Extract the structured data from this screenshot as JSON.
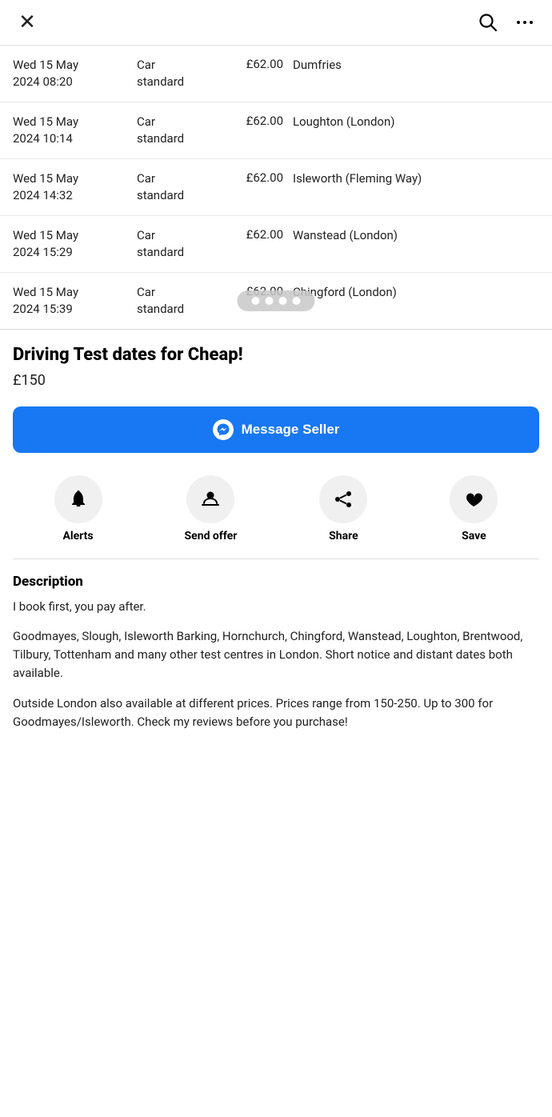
{
  "nav": {
    "close_label": "×",
    "search_label": "search",
    "more_label": "more options"
  },
  "table": {
    "rows": [
      {
        "date": "Wed 15 May 2024 08:20",
        "type": "Car standard",
        "price": "£62.00",
        "location": "Dumfries"
      },
      {
        "date": "Wed 15 May 2024 10:14",
        "type": "Car standard",
        "price": "£62.00",
        "location": "Loughton (London)"
      },
      {
        "date": "Wed 15 May 2024 14:32",
        "type": "Car standard",
        "price": "£62.00",
        "location": "Isleworth (Fleming Way)"
      },
      {
        "date": "Wed 15 May 2024 15:29",
        "type": "Car standard",
        "price": "£62.00",
        "location": "Wanstead (London)"
      },
      {
        "date": "Wed 15 May 2024 15:39",
        "type": "Car standard",
        "price": "£62.00",
        "location": "Chingford (London)"
      }
    ]
  },
  "listing": {
    "title": "Driving Test dates for Cheap!",
    "price": "£150",
    "message_btn_label": "Message Seller"
  },
  "actions": [
    {
      "id": "alerts",
      "label": "Alerts",
      "icon": "bell"
    },
    {
      "id": "send-offer",
      "label": "Send offer",
      "icon": "hand-coin"
    },
    {
      "id": "share",
      "label": "Share",
      "icon": "share"
    },
    {
      "id": "save",
      "label": "Save",
      "icon": "heart"
    }
  ],
  "description": {
    "title": "Description",
    "paragraphs": [
      "I book first, you pay after.",
      "Goodmayes, Slough, Isleworth Barking, Hornchurch, Chingford, Wanstead, Loughton, Brentwood, Tilbury, Tottenham and many other test centres in London. Short notice and distant dates both available.",
      "Outside London also available at different prices. Prices range from 150-250. Up to 300 for Goodmayes/Isleworth. Check my reviews before you purchase!"
    ]
  }
}
